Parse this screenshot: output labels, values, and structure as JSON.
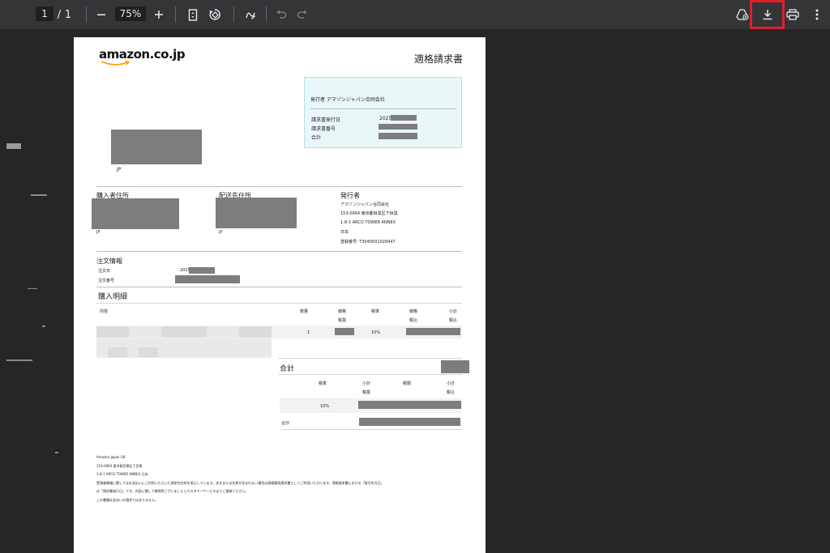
{
  "toolbar": {
    "page_current": "1",
    "page_sep": "/",
    "page_total": "1",
    "zoom_out_icon": "minus-icon",
    "zoom_value": "75%",
    "zoom_in_icon": "plus-icon",
    "fit_icon": "fit-page-icon",
    "rotate_icon": "rotate-icon",
    "annotate_icon": "pen-icon",
    "undo_icon": "undo-icon",
    "redo_icon": "redo-icon",
    "drive_icon": "add-to-drive-icon",
    "download_icon": "download-icon",
    "print_icon": "print-icon",
    "more_icon": "more-vert-icon",
    "highlight_color": "#e01e2a"
  },
  "invoice": {
    "logo": "amazon.co.jp",
    "title": "適格請求書",
    "issuer_box": {
      "issuer_label": "発行者 アマゾンジャパン合同会社",
      "date_label": "請求書発行日",
      "date_value": "2025-",
      "number_label": "請求書番号",
      "total_label": "合計"
    },
    "recipient_country": "JP",
    "buyer_address_label": "購入者住所",
    "buyer_country": "JP",
    "shipping_address_label": "配送先住所",
    "shipping_country": "JP",
    "issuer_section": {
      "label": "発行者",
      "line1": "アマゾンジャパン合同会社",
      "line2": "153-0064 東京都目黒区下目黒",
      "line3": "1-8-1 ARCO TOWER ANNEX",
      "line4": "日本",
      "line5": "登録番号: T3040001028447"
    },
    "order_info_label": "注文情報",
    "order_date_label": "注文日",
    "order_date_value": "2025-",
    "order_number_label": "注文番号",
    "details_label": "購入明細",
    "table_headers": {
      "content": "内容",
      "qty": "数量",
      "price": "価格",
      "price_sub": "税抜",
      "tax_rate": "税率",
      "price_incl": "価格",
      "price_incl_sub": "税込",
      "subtotal": "小計",
      "subtotal_sub": "税込"
    },
    "row": {
      "qty": "1",
      "tax_rate": "10%"
    },
    "total_section": {
      "label": "合計",
      "h_tax_rate": "税率",
      "h_subtotal": "小計",
      "h_subtotal_sub": "税抜",
      "h_tax": "税額",
      "h_subtotal2": "小計",
      "h_subtotal2_sub": "税込",
      "rate": "10%",
      "sum_label": "合計"
    },
    "footer": {
      "line1": "Amazon Japan GK",
      "line2": "153-0064 東京都目黒区下目黒",
      "line3": "1-8-1 ARCO TOWER ANNEX 日本",
      "line4": "受領者情報に関してはお支払いにご利用いただいた請求先住所を表示しています。氏名または名称が含まれない場合は適格簡易請求書としてご利用いただけます。適格請求書における「取引年月日」",
      "line5": "は「請求書発行日」です。内容に関して質問等ございましたらカスタマーサービスまでご連絡ください。",
      "line6": "この書類は支払いの請求ではありません。"
    }
  }
}
